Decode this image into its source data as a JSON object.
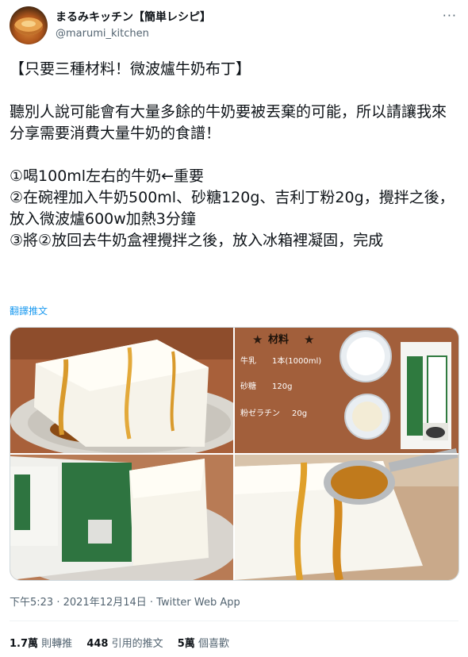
{
  "author": {
    "display_name": "まるみキッチン【簡単レシピ】",
    "handle": "@marumi_kitchen",
    "avatar_icon": "food-avatar-icon"
  },
  "more_icon": "more-options-icon",
  "tweet": {
    "title": "【只要三種材料！微波爐牛奶布丁】",
    "intro": "聽別人說可能會有大量多餘的牛奶要被丟棄的可能，所以請讓我來分享需要消費大量牛奶的食譜！",
    "step1": "①喝100ml左右的牛奶←重要",
    "step2": "②在碗裡加入牛奶500ml、砂糖120g、吉利丁粉20g，攪拌之後，放入微波爐600w加熱3分鐘",
    "step3": "③將②放回去牛奶盒裡攪拌之後，放入冰箱裡凝固，完成",
    "translate_label": "翻譯推文"
  },
  "media": {
    "ingredients_card": {
      "heading": "材料",
      "rows": [
        {
          "name": "牛乳",
          "amount": "1本(1000ml)"
        },
        {
          "name": "砂糖",
          "amount": "120g"
        },
        {
          "name": "粉ゼラチン",
          "amount": "20g"
        }
      ]
    }
  },
  "meta": {
    "time": "下午5:23",
    "date": "2021年12月14日",
    "source": "Twitter Web App"
  },
  "stats": {
    "retweets_count": "1.7萬",
    "retweets_label": "則轉推",
    "quotes_count": "448",
    "quotes_label": "引用的推文",
    "likes_count": "5萬",
    "likes_label": "個喜歡"
  },
  "colors": {
    "link": "#1d9bf0",
    "secondary_text": "#536471",
    "primary_text": "#0f1419"
  }
}
